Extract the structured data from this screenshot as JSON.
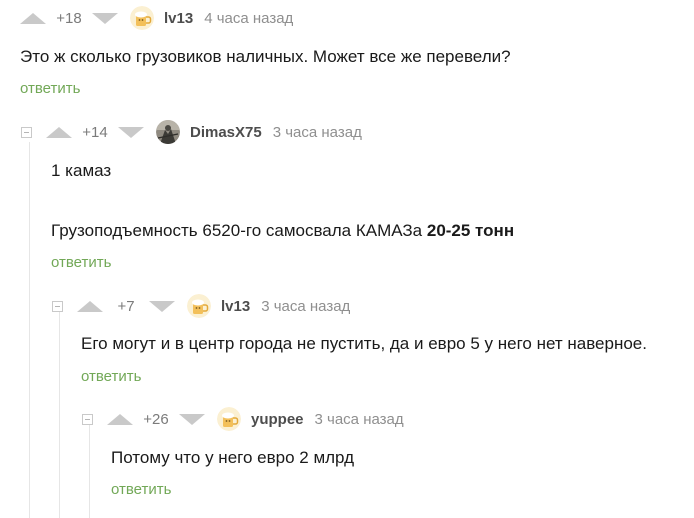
{
  "comments": [
    {
      "rating": "+18",
      "author": "lv13",
      "time": "4 часа назад",
      "text": "Это ж сколько грузовиков наличных. Может все же перевели?",
      "reply_label": "ответить"
    },
    {
      "rating": "+14",
      "author": "DimasX75",
      "time": "3 часа назад",
      "text_line1": "1 камаз",
      "text_line2_prefix": "Грузоподъемность 6520-го самосвала КАМАЗа ",
      "text_line2_bold": "20-25 тонн",
      "reply_label": "ответить"
    },
    {
      "rating": "+7",
      "author": "lv13",
      "time": "3 часа назад",
      "text": "Его могут и в центр города не пустить, да и евро 5 у него нет наверное.",
      "reply_label": "ответить"
    },
    {
      "rating": "+26",
      "author": "yuppee",
      "time": "3 часа назад",
      "text": "Потому что у него евро 2 млрд",
      "reply_label": "ответить"
    }
  ],
  "colors": {
    "reply_link": "#72a857",
    "vote_arrow": "#c9c9c9",
    "nick": "#4d4d4d",
    "time": "#8f8f8f"
  },
  "icons": {
    "upvote": "triangle-up-icon",
    "downvote": "triangle-down-icon",
    "collapse": "minus-box-icon",
    "avatar_lv13": "beer-mug-avatar",
    "avatar_yuppee": "beer-mug-avatar",
    "avatar_dimas": "photo-avatar"
  }
}
